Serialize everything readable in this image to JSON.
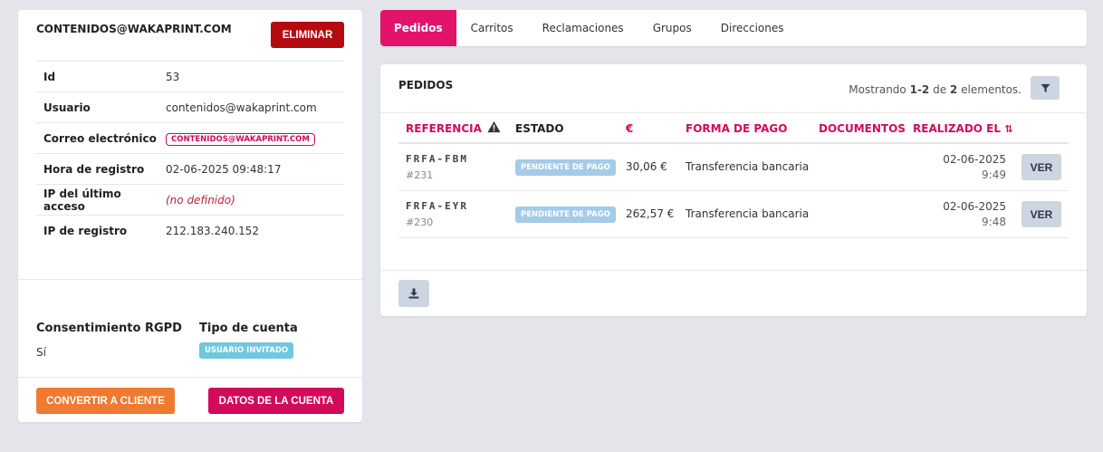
{
  "customer": {
    "email": "CONTENIDOS@WAKAPRINT.COM",
    "delete_label": "ELIMINAR",
    "fields": [
      {
        "label": "Id",
        "value": "53"
      },
      {
        "label": "Usuario",
        "value": "contenidos@wakaprint.com"
      },
      {
        "label": "Correo electrónico",
        "value": "CONTENIDOS@WAKAPRINT.COM"
      },
      {
        "label": "Hora de registro",
        "value": "02-06-2025 09:48:17"
      },
      {
        "label": "IP del último acceso",
        "value": "(no definido)"
      },
      {
        "label": "IP de registro",
        "value": "212.183.240.152"
      }
    ],
    "rgpd_label": "Consentimiento RGPD",
    "rgpd_value": "Sí",
    "account_type_label": "Tipo de cuenta",
    "account_type_value": "USUARIO INVITADO",
    "convert_label": "CONVERTIR A CLIENTE",
    "account_data_label": "DATOS DE LA CUENTA"
  },
  "tabs": [
    "Pedidos",
    "Carritos",
    "Reclamaciones",
    "Grupos",
    "Direcciones"
  ],
  "active_tab": "Pedidos",
  "orders": {
    "title": "PEDIDOS",
    "showing_prefix": "Mostrando ",
    "showing_range": "1-2",
    "showing_of": " de ",
    "showing_total": "2",
    "showing_suffix": " elementos.",
    "columns": {
      "reference": "REFERENCIA",
      "status": "ESTADO",
      "amount": "€",
      "payment": "FORMA DE PAGO",
      "documents": "DOCUMENTOS",
      "date": "REALIZADO EL"
    },
    "rows": [
      {
        "reference": "FRFA-FBM",
        "number": "#231",
        "status": "PENDIENTE DE PAGO",
        "amount": "30,06 €",
        "payment": "Transferencia bancaria",
        "date": "02-06-2025",
        "time": "9:49",
        "action": "VER"
      },
      {
        "reference": "FRFA-EYR",
        "number": "#230",
        "status": "PENDIENTE DE PAGO",
        "amount": "262,57 €",
        "payment": "Transferencia bancaria",
        "date": "02-06-2025",
        "time": "9:48",
        "action": "VER"
      }
    ]
  },
  "icons": {
    "filter": "filter-icon",
    "download": "download-icon",
    "warning": "warning-icon",
    "sort": "sort-icon"
  },
  "colors": {
    "primary": "#d10a5a",
    "danger": "#b30b10",
    "orange": "#f07a30",
    "info": "#6ec8de",
    "pending": "#a4cbe8"
  }
}
